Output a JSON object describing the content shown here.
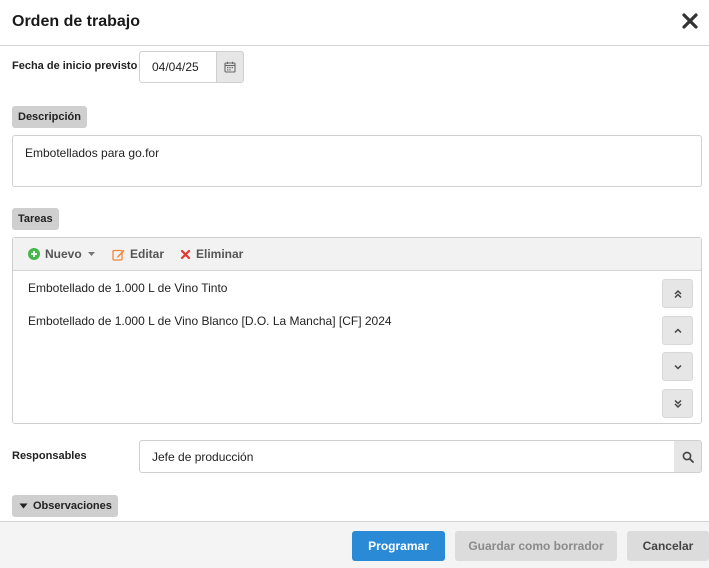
{
  "dialog": {
    "title": "Orden de trabajo",
    "close_icon": "close-icon"
  },
  "start_date": {
    "label": "Fecha de inicio previsto",
    "value": "04/04/25",
    "icon": "calendar-icon"
  },
  "description": {
    "label": "Descripción",
    "value": "Embotellados para go.for"
  },
  "tasks": {
    "label": "Tareas",
    "toolbar": {
      "new_label": "Nuevo",
      "edit_label": "Editar",
      "delete_label": "Eliminar"
    },
    "rows": [
      {
        "text": "Embotellado de 1.000 L de Vino Tinto"
      },
      {
        "text": "Embotellado de 1.000 L de Vino Blanco [D.O. La Mancha] [CF] 2024"
      }
    ]
  },
  "responsables": {
    "label": "Responsables",
    "value": "Jefe de producción",
    "icon": "search-icon"
  },
  "observations": {
    "label": "Observaciones"
  },
  "footer": {
    "schedule_label": "Programar",
    "draft_label": "Guardar como borrador",
    "cancel_label": "Cancelar"
  },
  "colors": {
    "primary": "#2b8ad6",
    "new_icon": "#45b649",
    "edit_icon": "#f0883a",
    "delete_icon": "#e53935"
  }
}
